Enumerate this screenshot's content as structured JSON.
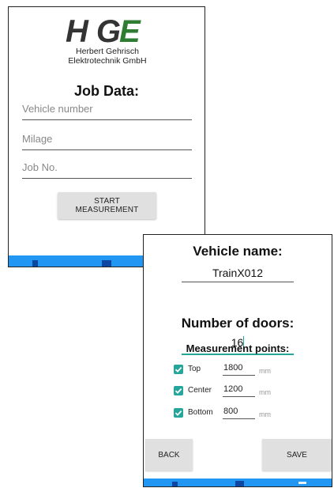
{
  "job_screen": {
    "logo": {
      "mark": "HGE",
      "line1": "Herbert Gehrisch",
      "line2": "Elektrotechnik GmbH"
    },
    "title": "Job Data:",
    "fields": {
      "vehicle_number": {
        "placeholder": "Vehicle number",
        "value": ""
      },
      "milage": {
        "placeholder": "Milage",
        "value": ""
      },
      "job_no": {
        "placeholder": "Job No.",
        "value": ""
      }
    },
    "start_button": "START MEASUREMENT"
  },
  "config_screen": {
    "vehicle_name_label": "Vehicle name:",
    "vehicle_name_value": "TrainX012",
    "doors_label": "Number of doors:",
    "doors_value": "16",
    "measurement_points_label": "Measurement points:",
    "points": [
      {
        "name": "Top",
        "value": "1800",
        "unit": "mm",
        "checked": true
      },
      {
        "name": "Center",
        "value": "1200",
        "unit": "mm",
        "checked": true
      },
      {
        "name": "Bottom",
        "value": "800",
        "unit": "mm",
        "checked": true
      }
    ],
    "back_button": "BACK",
    "save_button": "SAVE"
  },
  "colors": {
    "nav_bar": "#2196f3",
    "accent": "#26a69a",
    "logo_green": "#2e7d32",
    "logo_dark": "#333333"
  }
}
